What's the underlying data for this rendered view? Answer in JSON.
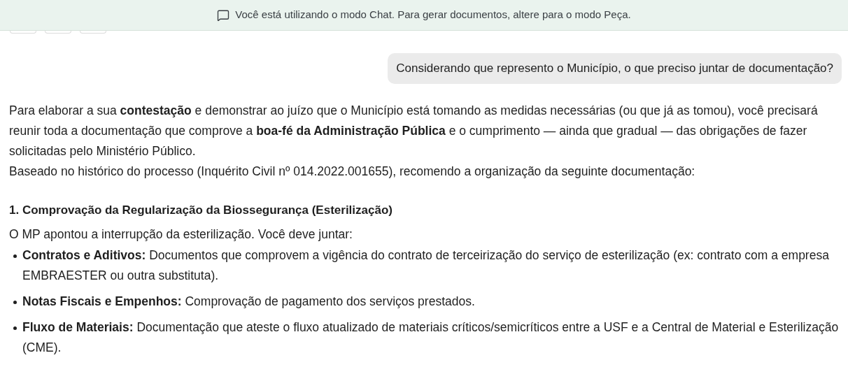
{
  "banner": {
    "text": "Você está utilizando o modo Chat. Para gerar documentos, altere para o modo Peça."
  },
  "toolbar": {
    "buttons": [
      {
        "kind": "button"
      },
      {
        "kind": "button"
      },
      {
        "kind": "button"
      }
    ]
  },
  "user_message": "Considerando que represento o Município, o que preciso juntar de documentação?",
  "answer": {
    "paragraphs": [
      "Para elaborar a sua **contestação** e demonstrar ao juízo que o Município está tomando as medidas necessárias (ou que já as tomou), você precisará reunir toda a documentação que comprove a **boa-fé da Administração Pública** e o cumprimento — ainda que gradual — das obrigações de fazer solicitadas pelo Ministério Público.",
      "Baseado no histórico do processo (Inquérito Civil nº 014.2022.001655), recomendo a organização da seguinte documentação:"
    ],
    "sections": [
      {
        "heading": "1. Comprovação da Regularização da Biossegurança (Esterilização)",
        "intro": "O MP apontou a interrupção da esterilização. Você deve juntar:",
        "bullets": [
          "**Contratos e Aditivos:** Documentos que comprovem a vigência do contrato de terceirização do serviço de esterilização (ex: contrato com a empresa EMBRAESTER ou outra substituta).",
          "**Notas Fiscais e Empenhos:** Comprovação de pagamento dos serviços prestados.",
          "**Fluxo de Materiais:** Documentação que ateste o fluxo atualizado de materiais críticos/semicríticos entre a USF e a Central de Material e Esterilização (CME)."
        ]
      }
    ]
  }
}
